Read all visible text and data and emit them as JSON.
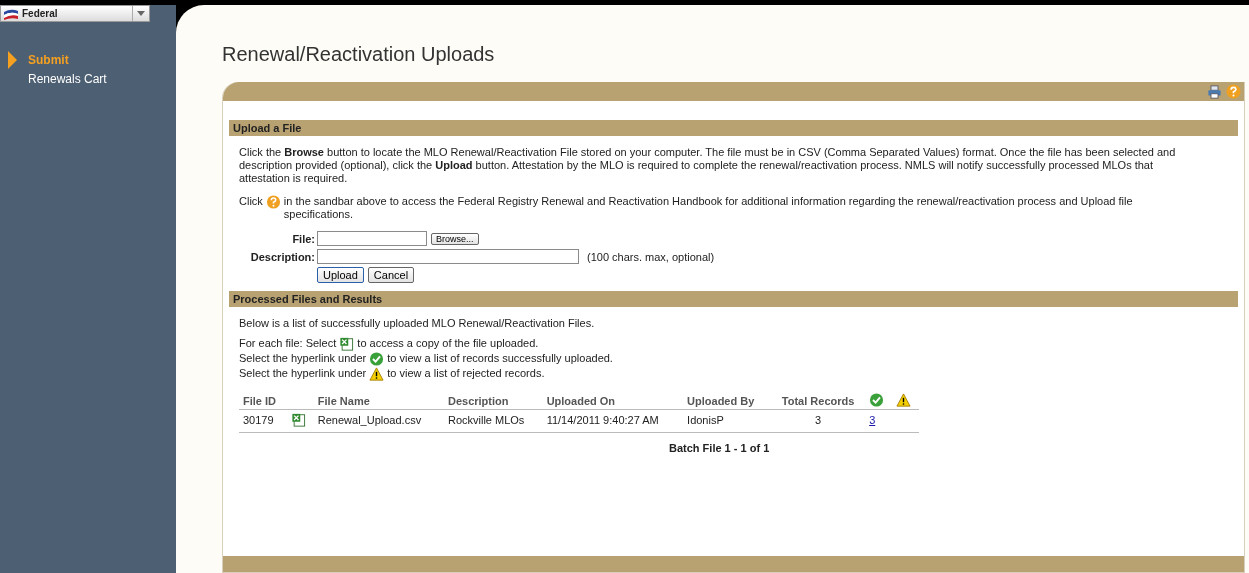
{
  "agency_select": {
    "value": "Federal"
  },
  "sidebar": {
    "items": [
      {
        "label": "Submit",
        "selected": true
      },
      {
        "label": "Renewals Cart",
        "selected": false
      }
    ]
  },
  "page_title": "Renewal/Reactivation Uploads",
  "upload_section": {
    "heading": "Upload a File",
    "intro": "Click the **Browse** button to locate the MLO Renewal/Reactivation File stored on your computer. The file must be in CSV (Comma Separated Values) format. Once the file has been selected and description provided (optional), click the **Upload** button. Attestation by the MLO is required to complete the renewal/reactivation process. NMLS will notify successfully processed MLOs that attestation is required.",
    "help_before": "Click",
    "help_after": "in the sandbar above to access the Federal Registry Renewal and Reactivation Handbook for additional information regarding the renewal/reactivation process and Upload file specifications.",
    "file_label": "File:",
    "browse_button": "Browse...",
    "description_label": "Description:",
    "description_hint": "(100 chars. max, optional)",
    "buttons": [
      "Upload",
      "Cancel"
    ]
  },
  "results_section": {
    "heading": "Processed Files and Results",
    "intro": "Below is a list of successfully uploaded MLO Renewal/Reactivation Files.",
    "instructions": [
      {
        "before": "For each file: Select",
        "kind": "excel",
        "after": "to access a copy of the file uploaded."
      },
      {
        "before": "Select the hyperlink under",
        "kind": "check",
        "after": "to view a list of records successfully uploaded."
      },
      {
        "before": "Select the hyperlink under",
        "kind": "warning",
        "after": "to view a list of rejected records."
      }
    ],
    "table": {
      "columns": [
        {
          "kind": "text",
          "label": "File ID"
        },
        {
          "kind": "blank"
        },
        {
          "kind": "text",
          "label": "File Name"
        },
        {
          "kind": "text",
          "label": "Description"
        },
        {
          "kind": "text",
          "label": "Uploaded On"
        },
        {
          "kind": "text",
          "label": "Uploaded By"
        },
        {
          "kind": "text",
          "label": "Total Records"
        },
        {
          "kind": "check"
        },
        {
          "kind": "warning"
        }
      ],
      "rows": [
        {
          "file_id": "30179",
          "file_name": "Renewal_Upload.csv",
          "description": "Rockville MLOs",
          "uploaded_on": "11/14/2011 9:40:27 AM",
          "uploaded_by": "IdonisP",
          "total_records": "3",
          "success_link": "3"
        }
      ]
    },
    "pager": "Batch File 1 - 1 of 1"
  }
}
